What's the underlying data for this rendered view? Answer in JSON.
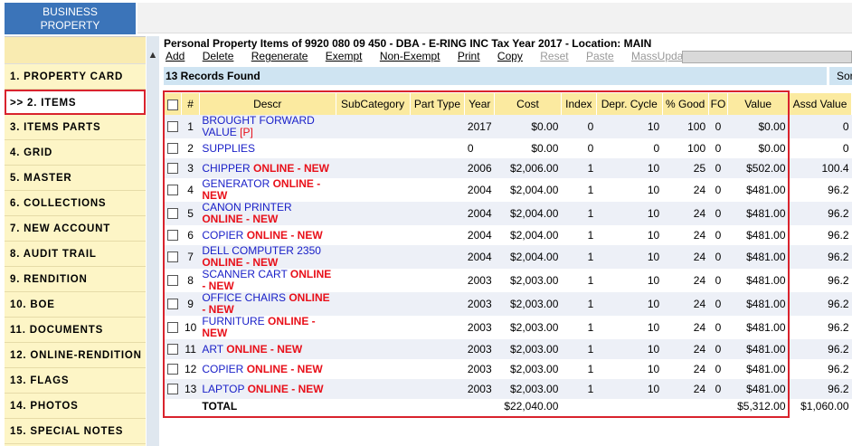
{
  "brand": {
    "line1": "BUSINESS",
    "line2": "PROPERTY"
  },
  "sidebar": {
    "items": [
      {
        "label": "1. PROPERTY CARD"
      },
      {
        "label": ">> 2. ITEMS",
        "active": true
      },
      {
        "label": "3. ITEMS PARTS"
      },
      {
        "label": "4. GRID"
      },
      {
        "label": "5. MASTER"
      },
      {
        "label": "6. COLLECTIONS"
      },
      {
        "label": "7. NEW ACCOUNT"
      },
      {
        "label": "8. AUDIT TRAIL"
      },
      {
        "label": "9. RENDITION"
      },
      {
        "label": "10. BOE"
      },
      {
        "label": "11. DOCUMENTS"
      },
      {
        "label": "12. ONLINE-RENDITION"
      },
      {
        "label": "13. FLAGS"
      },
      {
        "label": "14. PHOTOS"
      },
      {
        "label": "15. SPECIAL NOTES"
      }
    ]
  },
  "header": {
    "title": "Personal Property Items of 9920 080 09 450 - DBA - E-RING INC Tax Year  2017 - Location: MAIN",
    "collapse_icon": "chevron-up-icon"
  },
  "toolbar": {
    "add": "Add",
    "delete": "Delete",
    "regenerate": "Regenerate",
    "exempt": "Exempt",
    "non_exempt": "Non-Exempt",
    "print": "Print",
    "copy": "Copy",
    "reset": "Reset",
    "paste": "Paste",
    "mass_update": "MassUpdate"
  },
  "records": {
    "found": "13 Records Found",
    "sort_label": "Sor"
  },
  "table": {
    "headers": {
      "num": "#",
      "descr": "Descr",
      "subcategory": "SubCategory",
      "part_type": "Part Type",
      "year": "Year",
      "cost": "Cost",
      "index": "Index",
      "depr": "Depr. Cycle",
      "good": "% Good",
      "fo": "FO",
      "value": "Value",
      "assd": "Assd Value"
    },
    "rows": [
      {
        "num": "1",
        "descr": "BROUGHT FORWARD VALUE",
        "tag": "[P]",
        "online": "",
        "year": "2017",
        "cost": "$0.00",
        "index": "0",
        "depr": "10",
        "good": "100",
        "fo": "0",
        "value": "$0.00",
        "assd": "0"
      },
      {
        "num": "2",
        "descr": "SUPPLIES",
        "tag": "",
        "online": "",
        "year": "0",
        "cost": "$0.00",
        "index": "0",
        "depr": "0",
        "good": "100",
        "fo": "0",
        "value": "$0.00",
        "assd": "0"
      },
      {
        "num": "3",
        "descr": "CHIPPER",
        "tag": "",
        "online": "ONLINE - NEW",
        "year": "2006",
        "cost": "$2,006.00",
        "index": "1",
        "depr": "10",
        "good": "25",
        "fo": "0",
        "value": "$502.00",
        "assd": "100.4"
      },
      {
        "num": "4",
        "descr": "GENERATOR",
        "tag": "",
        "online": "ONLINE - NEW",
        "year": "2004",
        "cost": "$2,004.00",
        "index": "1",
        "depr": "10",
        "good": "24",
        "fo": "0",
        "value": "$481.00",
        "assd": "96.2"
      },
      {
        "num": "5",
        "descr": "CANON PRINTER",
        "tag": "",
        "online": "ONLINE - NEW",
        "year": "2004",
        "cost": "$2,004.00",
        "index": "1",
        "depr": "10",
        "good": "24",
        "fo": "0",
        "value": "$481.00",
        "assd": "96.2"
      },
      {
        "num": "6",
        "descr": "COPIER",
        "tag": "",
        "online": "ONLINE - NEW",
        "year": "2004",
        "cost": "$2,004.00",
        "index": "1",
        "depr": "10",
        "good": "24",
        "fo": "0",
        "value": "$481.00",
        "assd": "96.2"
      },
      {
        "num": "7",
        "descr": "DELL COMPUTER 2350",
        "tag": "",
        "online": "ONLINE - NEW",
        "year": "2004",
        "cost": "$2,004.00",
        "index": "1",
        "depr": "10",
        "good": "24",
        "fo": "0",
        "value": "$481.00",
        "assd": "96.2"
      },
      {
        "num": "8",
        "descr": "SCANNER CART",
        "tag": "",
        "online": "ONLINE - NEW",
        "year": "2003",
        "cost": "$2,003.00",
        "index": "1",
        "depr": "10",
        "good": "24",
        "fo": "0",
        "value": "$481.00",
        "assd": "96.2"
      },
      {
        "num": "9",
        "descr": "OFFICE CHAIRS",
        "tag": "",
        "online": "ONLINE - NEW",
        "year": "2003",
        "cost": "$2,003.00",
        "index": "1",
        "depr": "10",
        "good": "24",
        "fo": "0",
        "value": "$481.00",
        "assd": "96.2"
      },
      {
        "num": "10",
        "descr": "FURNITURE",
        "tag": "",
        "online": "ONLINE - NEW",
        "year": "2003",
        "cost": "$2,003.00",
        "index": "1",
        "depr": "10",
        "good": "24",
        "fo": "0",
        "value": "$481.00",
        "assd": "96.2"
      },
      {
        "num": "11",
        "descr": "ART",
        "tag": "",
        "online": "ONLINE - NEW",
        "year": "2003",
        "cost": "$2,003.00",
        "index": "1",
        "depr": "10",
        "good": "24",
        "fo": "0",
        "value": "$481.00",
        "assd": "96.2"
      },
      {
        "num": "12",
        "descr": "COPIER",
        "tag": "",
        "online": "ONLINE - NEW",
        "year": "2003",
        "cost": "$2,003.00",
        "index": "1",
        "depr": "10",
        "good": "24",
        "fo": "0",
        "value": "$481.00",
        "assd": "96.2"
      },
      {
        "num": "13",
        "descr": "LAPTOP",
        "tag": "",
        "online": "ONLINE - NEW",
        "year": "2003",
        "cost": "$2,003.00",
        "index": "1",
        "depr": "10",
        "good": "24",
        "fo": "0",
        "value": "$481.00",
        "assd": "96.2"
      }
    ],
    "total": {
      "label": "TOTAL",
      "cost": "$22,040.00",
      "value": "$5,312.00",
      "assd": "$1,060.00"
    }
  },
  "colors": {
    "accent": "#3b74b9",
    "header_bg": "#fbeaa0",
    "highlight": "#d9232d",
    "link": "#1a20c8",
    "online": "#e8101a"
  }
}
